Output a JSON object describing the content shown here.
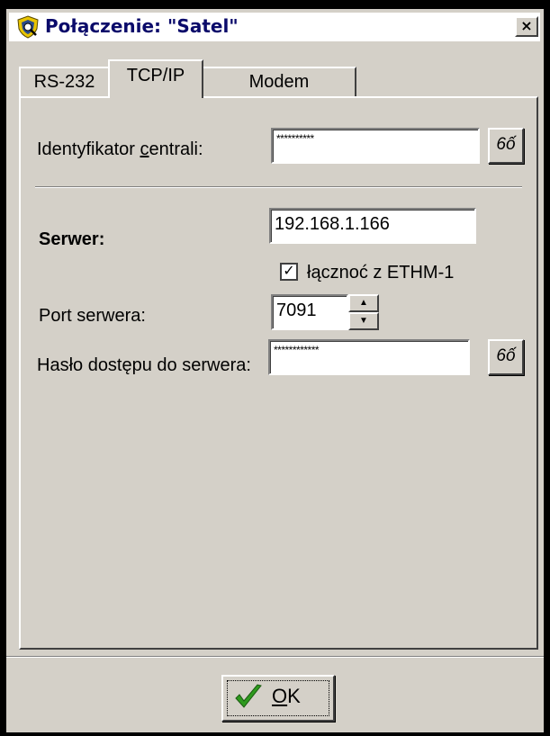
{
  "window": {
    "title": "Połączenie: \"Satel\"",
    "close_symbol": "×",
    "app_icon": "satel-shield-icon"
  },
  "tabs": [
    {
      "label": "RS-232",
      "active": false
    },
    {
      "label": "TCP/IP",
      "active": true
    },
    {
      "label": "Modem",
      "active": false
    }
  ],
  "form": {
    "central_id": {
      "label_pre": "Identyfikator ",
      "label_accel": "c",
      "label_post": "entrali:",
      "value": "**********"
    },
    "server": {
      "label": "Serwer:",
      "value": "192.168.1.166"
    },
    "ethm_checkbox": {
      "label": "łącznoć z ETHM-1",
      "checked": true,
      "mark": "✓"
    },
    "port": {
      "label": "Port serwera:",
      "value": "7091",
      "up_symbol": "▲",
      "down_symbol": "▼"
    },
    "server_password": {
      "label": "Hasło dostępu do serwera:",
      "value": "************"
    },
    "show_password_button_label": "6ố"
  },
  "footer": {
    "ok_label_accel": "O",
    "ok_label_rest": "K",
    "ok_icon": "green-check-icon"
  },
  "colors": {
    "face": "#d4d0c8",
    "title_text": "#0a0a6a",
    "check_green": "#2e9a1e"
  }
}
